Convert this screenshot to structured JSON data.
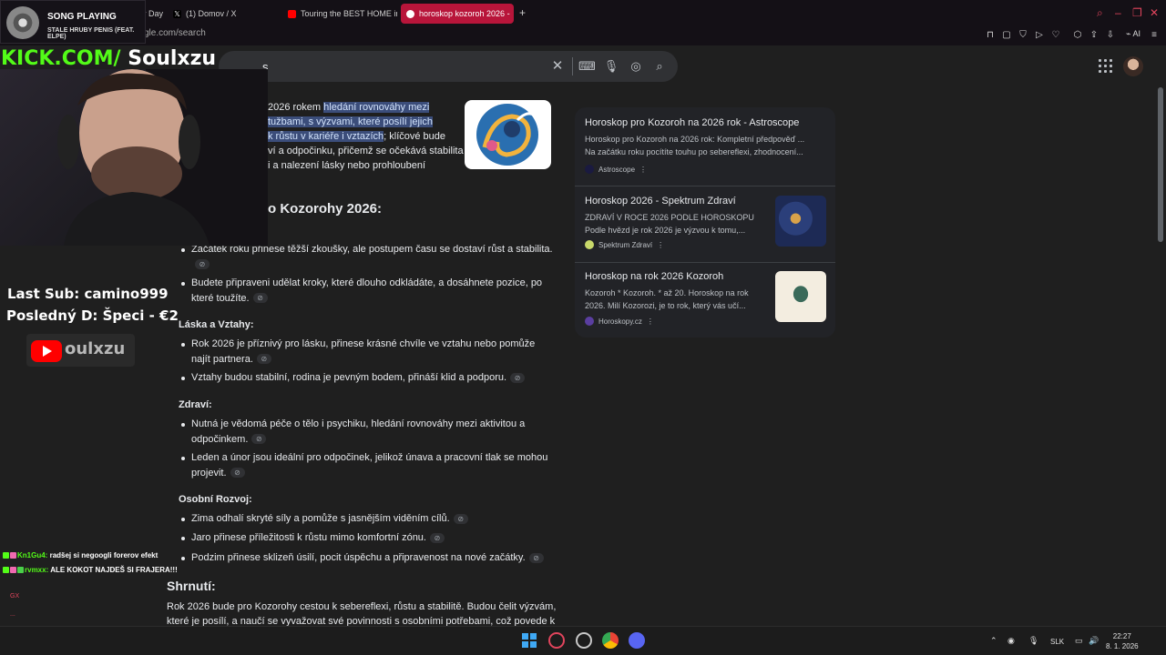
{
  "browser": {
    "tabs": [
      {
        "label": "Make Your Day"
      },
      {
        "label": "(1) Domov / X"
      },
      {
        "label": "Touring the BEST HOME in"
      },
      {
        "label": "horoskop kozoroh 2026 - "
      }
    ],
    "url_fragment": "gle.com/search",
    "ai_label": "AI"
  },
  "search": {
    "query_visible": "s"
  },
  "ai_overview": {
    "intro": {
      "line1_plain": "2026 rokem ",
      "line1_hl": "hledání rovnováhy mezi",
      "line2_hl": "tužbami, s výzvami, které posílí jejich",
      "line3_hl": "k růstu v kariéře i vztazích",
      "line3_plain": "; klíčové bude",
      "line4": "ví a odpočinku, přičemž se očekává stabilita",
      "line5": "i a nalezení lásky nebo prohloubení"
    },
    "heading": "o Kozorohy 2026:",
    "career_items": [
      {
        "text": "Začátek roku přinese těžší zkoušky, ale postupem času se dostaví růst a stabilita."
      },
      {
        "text": "Budete připraveni udělat kroky, které dlouho odkládáte, a dosáhnete pozice, po které toužíte."
      }
    ],
    "section_love": {
      "title": "Láska a Vztahy:",
      "items": [
        {
          "text": "Rok 2026 je příznivý pro lásku, přinese krásné chvíle ve vztahu nebo pomůže najít partnera."
        },
        {
          "text": "Vztahy budou stabilní, rodina je pevným bodem, přináší klid a podporu."
        }
      ]
    },
    "section_health": {
      "title": "Zdraví:",
      "items": [
        {
          "text": "Nutná je vědomá péče o tělo i psychiku, hledání rovnováhy mezi aktivitou a odpočinkem."
        },
        {
          "text": "Leden a únor jsou ideální pro odpočinek, jelikož únava a pracovní tlak se mohou projevit."
        }
      ]
    },
    "section_growth": {
      "title": "Osobní Rozvoj:",
      "items": [
        {
          "text": "Zima odhalí skryté síly a pomůže s jasnějším viděním cílů."
        },
        {
          "text": "Jaro přinese příležitosti k růstu mimo komfortní zónu."
        },
        {
          "text": "Podzim přinese sklizeň úsilí, pocit úspěchu a připravenost na nové začátky."
        }
      ]
    },
    "summary": {
      "title": "Shrnutí:",
      "line1": "Rok 2026 bude pro Kozorohy cestou k sebereflexi, růstu a stabilitě. Budou čelit výzvám,",
      "line2": "které je posílí, a naučí se vyvažovat své povinnosti s osobními potřebami, což povede k"
    }
  },
  "sources": [
    {
      "title": "Horoskop pro Kozoroh na 2026 rok - Astroscope",
      "snippet1": "Horoskop pro Kozoroh na 2026 rok: Kompletní předpověď ...",
      "snippet2": "Na začátku roku pocítíte touhu po sebereflexi, zhodnocení...",
      "site": "Astroscope"
    },
    {
      "title": "Horoskop 2026 - Spektrum Zdraví",
      "snippet1": "ZDRAVÍ V ROCE 2026 PODLE HOROSKOPU",
      "snippet2": "Podle hvězd je rok 2026 je výzvou k tomu,...",
      "site": "Spektrum Zdraví"
    },
    {
      "title": "Horoskop na rok 2026 Kozoroh",
      "snippet1": "Kozoroh * Kozoroh. * až 20. Horoskop na rok",
      "snippet2": "2026. Milí Kozorozi, je to rok, který vás učí...",
      "site": "Horoskopy.cz"
    }
  ],
  "stream": {
    "song_label": "SONG PLAYING",
    "song_artist": "STALE HRUBY PENIS (FEAT. ELPE)",
    "kick_prefix": "KICK.COM/",
    "kick_name": "Soulxzu",
    "last_sub": "Last Sub: camino999",
    "last_d": "Posledný D: Špeci - €2",
    "yt_name": "oulxzu",
    "chat": [
      {
        "user": "Kn1Gu4:",
        "msg": "radšej si negoogli forerov efekt"
      },
      {
        "user": "rvmxx:",
        "msg": "ALE KOKOT NAJDEŠ SI FRAJERA!!!"
      }
    ],
    "side_a": "GX",
    "side_b": "..."
  },
  "taskbar": {
    "lang": "SLK",
    "time": "22:27",
    "date": "8. 1. 2026"
  },
  "colors": {
    "accent_tab": "#b8153a",
    "kick_green": "#53fc18",
    "highlight": "#3b4d7a"
  }
}
